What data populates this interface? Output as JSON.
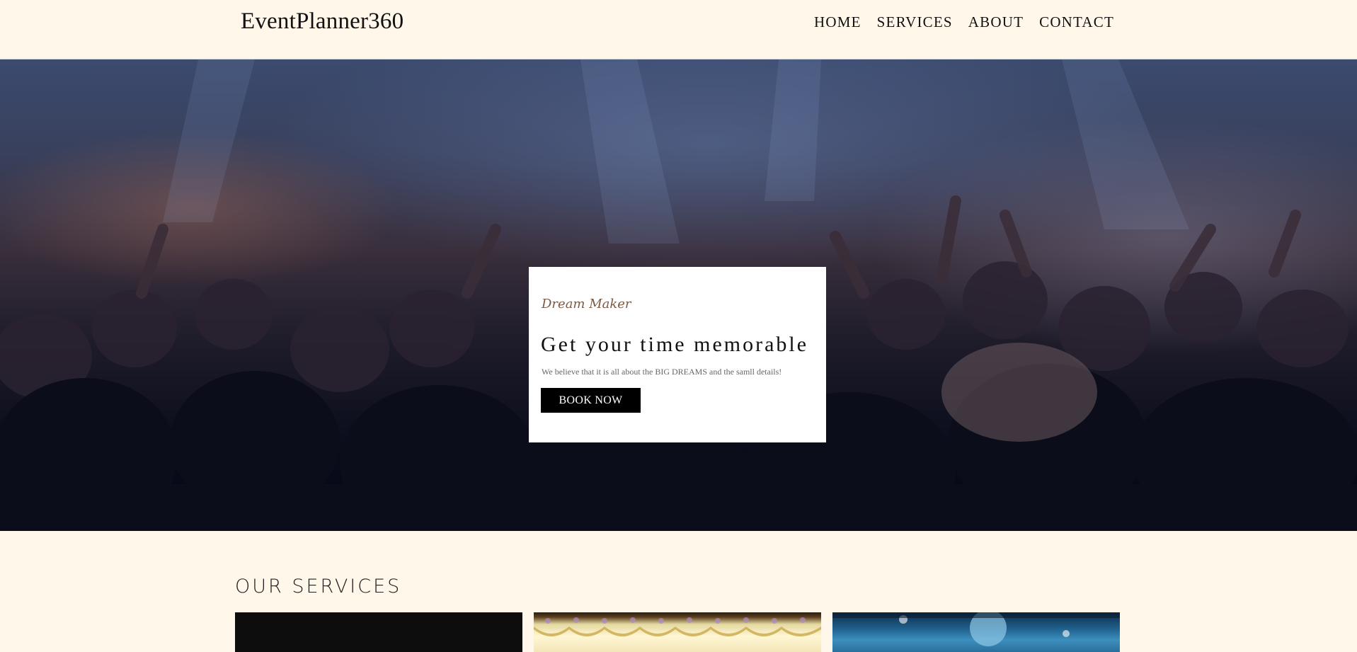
{
  "header": {
    "logo": "EventPlanner360",
    "nav": [
      {
        "label": "HOME"
      },
      {
        "label": "SERVICES"
      },
      {
        "label": "ABOUT"
      },
      {
        "label": "CONTACT"
      }
    ]
  },
  "hero": {
    "image": "concert-crowd-photo",
    "card": {
      "tagline": "Dream Maker",
      "headline": "Get your time memorable",
      "subtext": "We believe that it is all about the BIG DREAMS and the samll details!",
      "button_label": "BOOK NOW"
    }
  },
  "services": {
    "title": "OUR SERVICES",
    "cards": [
      {
        "image": "dark-service-photo"
      },
      {
        "image": "stage-decoration-photo"
      },
      {
        "image": "disco-ball-party-photo"
      }
    ]
  },
  "colors": {
    "page_bg": "#fff7e9",
    "button_bg": "#000000",
    "tagline": "#7b5a45"
  }
}
